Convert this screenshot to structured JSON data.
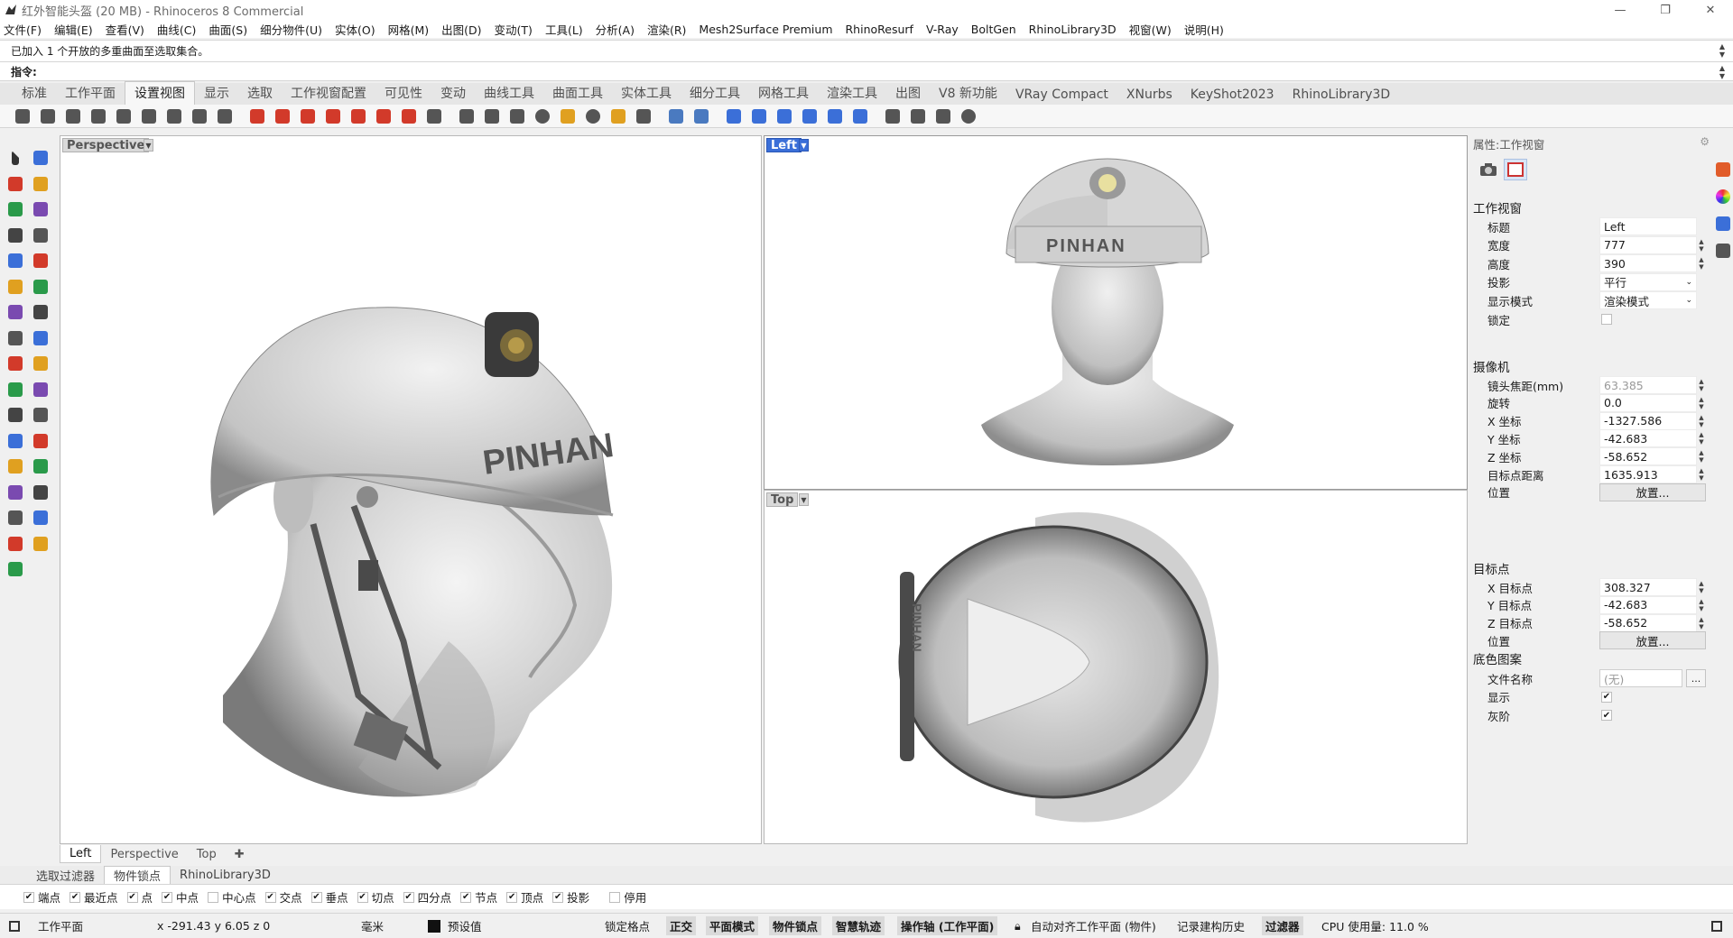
{
  "window": {
    "title": "红外智能头盔 (20 MB) - Rhinoceros 8 Commercial",
    "controls": [
      "—",
      "❐",
      "✕"
    ]
  },
  "menu": [
    "文件(F)",
    "编辑(E)",
    "查看(V)",
    "曲线(C)",
    "曲面(S)",
    "细分物件(U)",
    "实体(O)",
    "网格(M)",
    "出图(D)",
    "变动(T)",
    "工具(L)",
    "分析(A)",
    "渲染(R)",
    "Mesh2Surface Premium",
    "RhinoResurf",
    "V-Ray",
    "BoltGen",
    "RhinoLibrary3D",
    "视窗(W)",
    "说明(H)"
  ],
  "command": {
    "history": "已加入 1 个开放的多重曲面至选取集合。",
    "prompt": "指令:"
  },
  "toolbar_tabs": {
    "items": [
      "标准",
      "工作平面",
      "设置视图",
      "显示",
      "选取",
      "工作视窗配置",
      "可见性",
      "变动",
      "曲线工具",
      "曲面工具",
      "实体工具",
      "细分工具",
      "网格工具",
      "渲染工具",
      "出图",
      "V8 新功能",
      "VRay Compact",
      "XNurbs",
      "KeyShot2023",
      "RhinoLibrary3D"
    ],
    "active": "设置视图"
  },
  "toolbar_icons": [
    "pan-icon",
    "rotate-icon",
    "zoom-icon",
    "zoom-window-icon",
    "zoom-extents-icon",
    "zoom-selected-icon",
    "undo-view-icon",
    "zoom-out-icon",
    "zoom-1to1-icon",
    "red-car-1-icon",
    "red-car-2-icon",
    "red-car-3-icon",
    "red-car-4-icon",
    "red-car-5-icon",
    "red-car-6-icon",
    "red-car-7-icon",
    "camera-set-icon",
    "camera-icon",
    "named-view-icon",
    "wallpaper-icon",
    "target-icon",
    "light-icon",
    "circle-target-icon",
    "sun-icon",
    "person-icon",
    "material-icon",
    "cube-view-icon",
    "plane-1-icon",
    "plane-2-icon",
    "plane-3-icon",
    "plane-4-icon",
    "plane-5-icon",
    "plane-6-icon",
    "turntable-360-icon",
    "walkabout-icon",
    "spin-icon",
    "crosshair-icon"
  ],
  "viewports": {
    "perspective": {
      "label": "Perspective"
    },
    "left": {
      "label": "Left"
    },
    "top": {
      "label": "Top"
    },
    "helmet_text": "PINHAN"
  },
  "bottom_tabs": {
    "items": [
      "Left",
      "Perspective",
      "Top"
    ],
    "active": "Left",
    "add": "✚"
  },
  "properties": {
    "header": "属性:工作视窗",
    "sections": {
      "viewport": "工作视窗",
      "camera": "摄像机",
      "target": "目标点",
      "background": "底色图案"
    },
    "viewport_rows": [
      {
        "label": "标题",
        "value": "Left"
      },
      {
        "label": "宽度",
        "value": "777"
      },
      {
        "label": "高度",
        "value": "390"
      },
      {
        "label": "投影",
        "value": "平行"
      },
      {
        "label": "显示模式",
        "value": "渲染模式"
      },
      {
        "label": "锁定",
        "value": ""
      }
    ],
    "camera_rows": [
      {
        "label": "镜头焦距(mm)",
        "value": "63.385"
      },
      {
        "label": "旋转",
        "value": "0.0"
      },
      {
        "label": "X 坐标",
        "value": "-1327.586"
      },
      {
        "label": "Y 坐标",
        "value": "-42.683"
      },
      {
        "label": "Z 坐标",
        "value": "-58.652"
      },
      {
        "label": "目标点距离",
        "value": "1635.913"
      },
      {
        "label": "位置",
        "value": "放置..."
      }
    ],
    "target_rows": [
      {
        "label": "X 目标点",
        "value": "308.327"
      },
      {
        "label": "Y 目标点",
        "value": "-42.683"
      },
      {
        "label": "Z 目标点",
        "value": "-58.652"
      },
      {
        "label": "位置",
        "value": "放置..."
      }
    ],
    "background_rows": [
      {
        "label": "文件名称",
        "value": "(无)"
      },
      {
        "label": "显示",
        "value": "✔"
      },
      {
        "label": "灰阶",
        "value": "✔"
      }
    ],
    "file_button": "..."
  },
  "osnap_tabs": {
    "items": [
      "选取过滤器",
      "物件锁点",
      "RhinoLibrary3D"
    ],
    "active": "物件锁点"
  },
  "osnaps": [
    {
      "label": "端点",
      "checked": true
    },
    {
      "label": "最近点",
      "checked": true
    },
    {
      "label": "点",
      "checked": true
    },
    {
      "label": "中点",
      "checked": true
    },
    {
      "label": "中心点",
      "checked": false
    },
    {
      "label": "交点",
      "checked": true
    },
    {
      "label": "垂点",
      "checked": true
    },
    {
      "label": "切点",
      "checked": true
    },
    {
      "label": "四分点",
      "checked": true
    },
    {
      "label": "节点",
      "checked": true
    },
    {
      "label": "顶点",
      "checked": true
    },
    {
      "label": "投影",
      "checked": true
    },
    {
      "label": "停用",
      "checked": false
    }
  ],
  "status": {
    "cplane": "工作平面",
    "coords": "x -291.43  y 6.05  z 0",
    "unit": "毫米",
    "layer": "预设值",
    "grid_snap": "锁定格点",
    "ortho": "正交",
    "planar": "平面模式",
    "osnap": "物件锁点",
    "smarttrack": "智慧轨迹",
    "gumball": "操作轴 (工作平面)",
    "autoalign": "自动对齐工作平面 (物件)",
    "history": "记录建构历史",
    "filter": "过滤器",
    "cpu": "CPU 使用量: 11.0 %"
  },
  "left_toolbar_icons": [
    "select-icon",
    "point-icon",
    "polyline-icon",
    "curve-icon",
    "circle-icon",
    "ellipse-icon",
    "polygon-icon",
    "rectangle-icon",
    "arc-icon",
    "fillet-icon",
    "surface-icon",
    "loft-icon",
    "box-icon",
    "boolean-icon",
    "extrude-icon",
    "sweep-icon",
    "mesh-icon",
    "explode-icon",
    "trim-icon",
    "split-icon",
    "group-icon",
    "layer-icon",
    "dimension-icon",
    "text-icon",
    "transform-icon",
    "scale-icon",
    "array-icon",
    "align-icon",
    "analyze-icon",
    "render-icon",
    "check-icon",
    "solid-icon",
    "paint-icon"
  ]
}
